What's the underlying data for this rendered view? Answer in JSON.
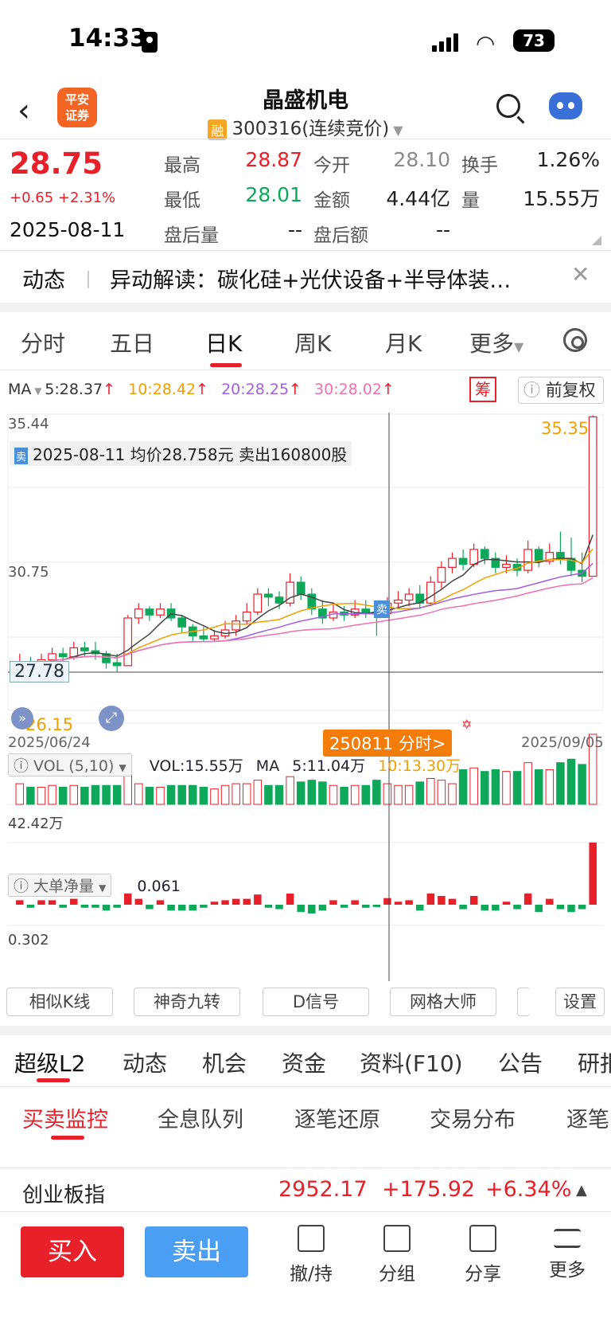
{
  "status_bar": {
    "time": "14:33",
    "battery": "73"
  },
  "header": {
    "logo": "平安\n证券",
    "stock_name": "晶盛机电",
    "margin_badge": "融",
    "stock_code": "300316(连续竞价)"
  },
  "quote": {
    "price": "28.75",
    "change": "+0.65 +2.31%",
    "date": "2025-08-11",
    "high_label": "最高",
    "high": "28.87",
    "open_label": "今开",
    "open": "28.10",
    "turnover_label": "换手",
    "turnover": "1.26%",
    "low_label": "最低",
    "low": "28.01",
    "amount_label": "金额",
    "amount": "4.44亿",
    "volume_label": "量",
    "volume": "15.55万",
    "after_vol_label": "盘后量",
    "after_vol": "--",
    "after_amt_label": "盘后额",
    "after_amt": "--"
  },
  "news": {
    "tag": "动态",
    "text": "异动解读：碳化硅+光伏设备+半导体装…"
  },
  "chart_tabs": [
    "分时",
    "五日",
    "日K",
    "周K",
    "月K",
    "更多"
  ],
  "chart": {
    "ma_label": "MA",
    "ma5": "5:28.37",
    "ma10": "10:28.42",
    "ma20": "20:28.25",
    "ma30": "30:28.02",
    "chou": "筹",
    "fuquan": "前复权",
    "y_top": "35.44",
    "y_mid": "30.75",
    "y_low": "2",
    "cross_price": "27.78",
    "max_label": "35.35",
    "min_label": "26.15",
    "tooltip_badge": "卖",
    "tooltip": "2025-08-11 均价28.758元 卖出160800股",
    "date_start": "2025/06/24",
    "date_end": "2025/09/05",
    "cross_date": "250811 分时>",
    "vol_indicator": "VOL (5,10)",
    "vol_value": "VOL:15.55万",
    "vol_ma_label": "MA",
    "vol_ma5": "5:11.04万",
    "vol_ma10": "10:13.30万",
    "vol_axis": "42.42万",
    "flow_indicator": "大单净量",
    "flow_value": "0.061",
    "flow_axis": "0.302",
    "marker": "卖"
  },
  "chart_data": {
    "type": "candlestick",
    "x_range": [
      "2025/06/24",
      "2025/09/05"
    ],
    "ylim": [
      25.5,
      35.44
    ],
    "candles": [
      [
        26.9,
        27.1,
        26.7,
        27.4
      ],
      [
        27.1,
        27.0,
        26.8,
        27.3
      ],
      [
        27.0,
        27.2,
        26.9,
        27.4
      ],
      [
        27.2,
        27.4,
        27.0,
        27.6
      ],
      [
        27.4,
        27.3,
        27.1,
        27.6
      ],
      [
        27.3,
        27.6,
        27.2,
        27.8
      ],
      [
        27.6,
        27.5,
        27.3,
        27.8
      ],
      [
        27.5,
        27.4,
        27.2,
        27.8
      ],
      [
        27.4,
        27.1,
        26.9,
        27.5
      ],
      [
        27.1,
        27.0,
        26.8,
        27.4
      ],
      [
        27.0,
        28.6,
        27.0,
        28.7
      ],
      [
        28.6,
        28.9,
        28.4,
        29.1
      ],
      [
        28.9,
        28.7,
        28.5,
        29.0
      ],
      [
        28.7,
        28.9,
        28.6,
        29.1
      ],
      [
        28.9,
        28.6,
        28.5,
        29.1
      ],
      [
        28.6,
        28.3,
        28.1,
        28.7
      ],
      [
        28.3,
        28.0,
        27.8,
        28.4
      ],
      [
        28.0,
        27.9,
        27.8,
        28.3
      ],
      [
        27.9,
        28.0,
        27.8,
        28.2
      ],
      [
        28.0,
        28.2,
        27.9,
        28.5
      ],
      [
        28.2,
        28.5,
        28.0,
        28.7
      ],
      [
        28.5,
        28.8,
        28.4,
        29.1
      ],
      [
        28.8,
        29.4,
        28.7,
        29.6
      ],
      [
        29.4,
        29.3,
        29.0,
        29.6
      ],
      [
        29.3,
        29.1,
        28.9,
        29.5
      ],
      [
        29.1,
        29.8,
        29.0,
        30.1
      ],
      [
        29.8,
        29.4,
        29.2,
        30.0
      ],
      [
        29.4,
        28.9,
        28.7,
        29.6
      ],
      [
        28.9,
        28.6,
        28.4,
        29.2
      ],
      [
        28.6,
        28.8,
        28.5,
        29.1
      ],
      [
        28.8,
        28.7,
        28.5,
        29.0
      ],
      [
        28.7,
        28.9,
        28.6,
        29.2
      ],
      [
        28.9,
        28.8,
        28.6,
        29.2
      ],
      [
        28.8,
        28.75,
        28.0,
        28.9
      ],
      [
        28.75,
        29.1,
        28.6,
        29.3
      ],
      [
        29.1,
        29.2,
        28.9,
        29.5
      ],
      [
        29.2,
        29.4,
        29.0,
        29.6
      ],
      [
        29.4,
        29.1,
        28.9,
        29.7
      ],
      [
        29.1,
        29.8,
        29.0,
        30.0
      ],
      [
        29.8,
        30.3,
        29.6,
        30.5
      ],
      [
        30.3,
        30.6,
        30.1,
        30.8
      ],
      [
        30.6,
        30.4,
        30.2,
        30.9
      ],
      [
        30.4,
        30.9,
        30.3,
        31.1
      ],
      [
        30.9,
        30.6,
        30.4,
        31.0
      ],
      [
        30.6,
        30.3,
        30.1,
        30.8
      ],
      [
        30.3,
        30.4,
        30.1,
        30.7
      ],
      [
        30.4,
        30.2,
        30.0,
        30.6
      ],
      [
        30.2,
        30.9,
        30.1,
        31.2
      ],
      [
        30.9,
        30.5,
        30.3,
        31.0
      ],
      [
        30.5,
        30.8,
        30.4,
        31.1
      ],
      [
        30.8,
        30.6,
        30.4,
        31.5
      ],
      [
        30.6,
        30.2,
        30.0,
        31.3
      ],
      [
        30.2,
        30.0,
        29.8,
        30.8
      ],
      [
        30.0,
        35.35,
        30.0,
        35.4
      ]
    ],
    "volume_axis_label": "42.42万",
    "flow_axis_label": "0.302"
  },
  "tools": [
    "相似K线",
    "神奇九转",
    "D信号",
    "网格大师",
    "设置"
  ],
  "bottom_tabs": [
    "超级L2",
    "动态",
    "机会",
    "资金",
    "资料(F10)",
    "公告",
    "研报"
  ],
  "sub_tabs": [
    "买卖监控",
    "全息队列",
    "逐笔还原",
    "交易分布",
    "逐笔"
  ],
  "index_bar": {
    "name": "创业板指",
    "value": "2952.17",
    "change": "+175.92",
    "pct": "+6.34%"
  },
  "actions": {
    "buy": "买入",
    "sell": "卖出",
    "withdraw": "撤/持",
    "group": "分组",
    "share": "分享",
    "more": "更多"
  }
}
